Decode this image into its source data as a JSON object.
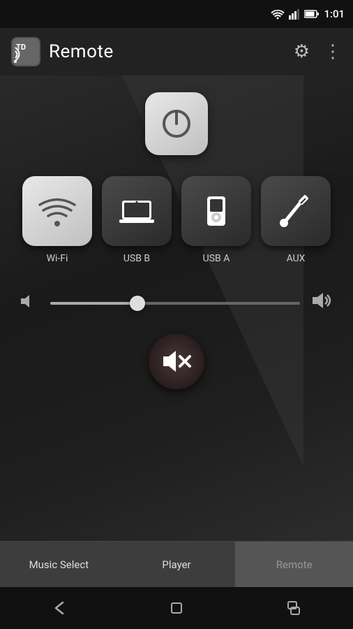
{
  "statusBar": {
    "time": "1:01"
  },
  "appBar": {
    "logoText": "TD",
    "title": "Remote",
    "gearIcon": "⚙",
    "moreIcon": "⋮"
  },
  "powerButton": {
    "label": "Power"
  },
  "sources": [
    {
      "id": "wifi",
      "label": "Wi-Fi",
      "style": "light"
    },
    {
      "id": "usb-b",
      "label": "USB B",
      "style": "dark"
    },
    {
      "id": "usb-a",
      "label": "USB A",
      "style": "dark"
    },
    {
      "id": "aux",
      "label": "AUX",
      "style": "dark"
    }
  ],
  "volume": {
    "minIcon": "🔈",
    "maxIcon": "🔊",
    "value": 35
  },
  "muteButton": {
    "label": "Mute"
  },
  "tabs": [
    {
      "id": "music-select",
      "label": "Music Select",
      "active": false
    },
    {
      "id": "player",
      "label": "Player",
      "active": false
    },
    {
      "id": "remote",
      "label": "Remote",
      "active": true
    }
  ],
  "navBar": {
    "backLabel": "Back",
    "homeLabel": "Home",
    "recentLabel": "Recent"
  }
}
